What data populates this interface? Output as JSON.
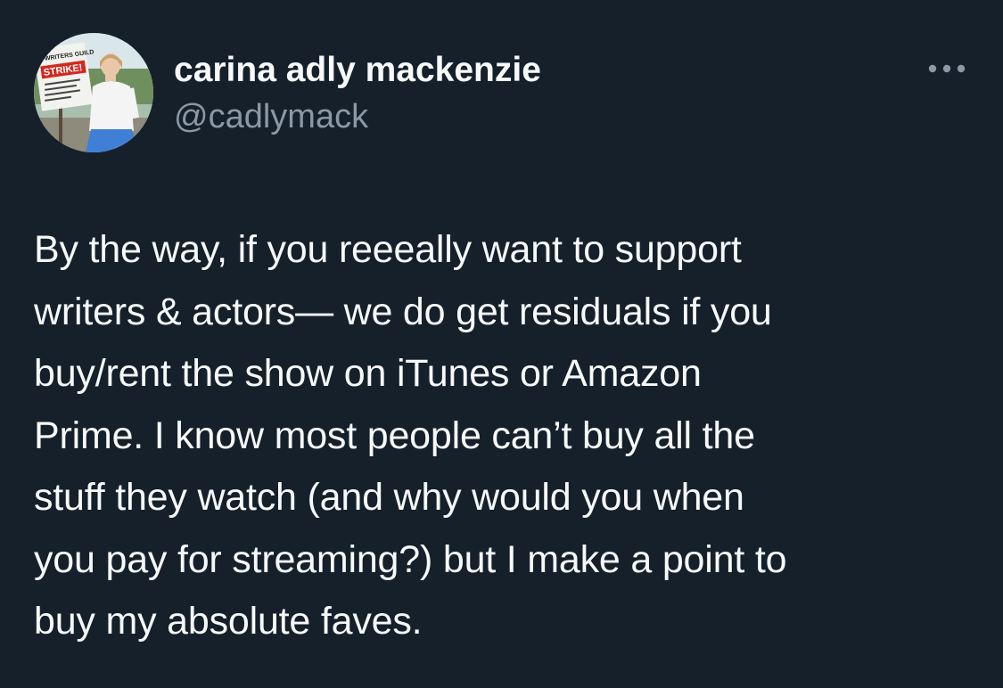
{
  "author": {
    "display_name": "carina adly mackenzie",
    "handle": "@cadlymack",
    "avatar_sign": {
      "top": "WRITERS GUILD",
      "main": "STRIKE!"
    }
  },
  "tweet": {
    "text": "By the way, if you reeeally want to support\nwriters & actors— we do get residuals if you\nbuy/rent the show on iTunes or Amazon\nPrime. I know most people can’t buy all the\nstuff they watch (and why would you when\nyou pay for streaming?) but I make a point to\nbuy my absolute faves."
  },
  "actions": {
    "more_icon": "more-horizontal-icon"
  },
  "colors": {
    "background": "#15202b",
    "primary_text": "#f7f9f9",
    "secondary_text": "#8b98a5"
  }
}
